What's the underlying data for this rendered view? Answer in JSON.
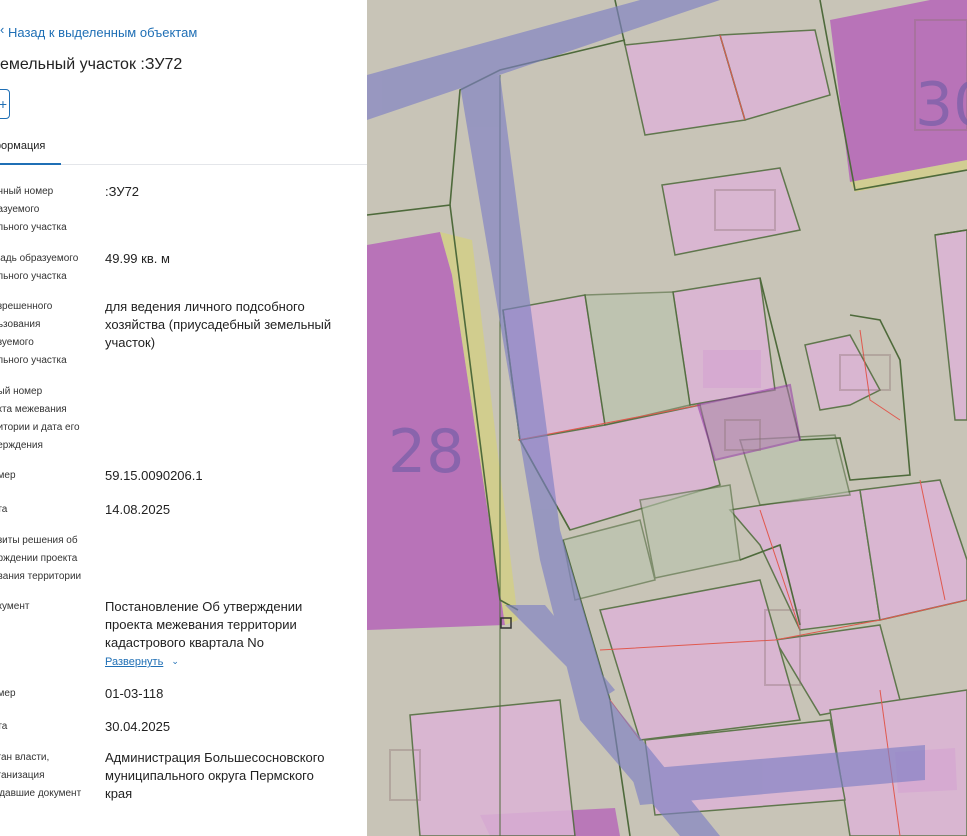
{
  "back_link": "Назад к выделенным объектам",
  "title": "емельный участок :ЗУ72",
  "action_button_symbol": "+",
  "tabs": [
    {
      "label": "формация",
      "active": true
    }
  ],
  "fields": [
    {
      "label": "енный номер\nразуемого\nельного участка",
      "value": ":ЗУ72"
    },
    {
      "label": "щадь образуемого\nельного участка",
      "value": "49.99 кв. м"
    },
    {
      "label": "азрешенного\nльзования\nазуемого\nельного участка",
      "value": "для ведения личного подсобного\nхозяйства (приусадебный земельный\nучасток)"
    },
    {
      "label": "ный номер\nекта межевания\nритории и дата его\nверждения",
      "value": ""
    },
    {
      "label": "омер",
      "value": "59.15.0090206.1"
    },
    {
      "label": "ата",
      "value": "14.08.2025"
    },
    {
      "label": "изиты решения об\nерждении проекта\nевания территории",
      "value": ""
    },
    {
      "label": "окумент",
      "value": "Постановление Об утверждении\nпроекта межевания территории\nкадастрового квартала No"
    },
    {
      "label": "омер",
      "value": "01-03-118"
    },
    {
      "label": "ата",
      "value": "30.04.2025"
    },
    {
      "label": "рган власти,\nрганизация\nыдавшие документ",
      "value": "Администрация Большесосновского\nмуниципального округа Пермского\nкрая"
    }
  ],
  "expand_label": "Развернуть",
  "map": {
    "labels": [
      "28",
      "30"
    ],
    "colors": {
      "background": "#c8c4b7",
      "parcel_fill": "#dcb4d6",
      "zone_fill": "#b565b8",
      "road_fill": "#7e80c4",
      "highlight_fill": "#d9d56e",
      "boundary_stroke": "#4e6a3b",
      "cadastral_stroke": "#e0594f",
      "selected_stroke": "#9333a8"
    }
  }
}
